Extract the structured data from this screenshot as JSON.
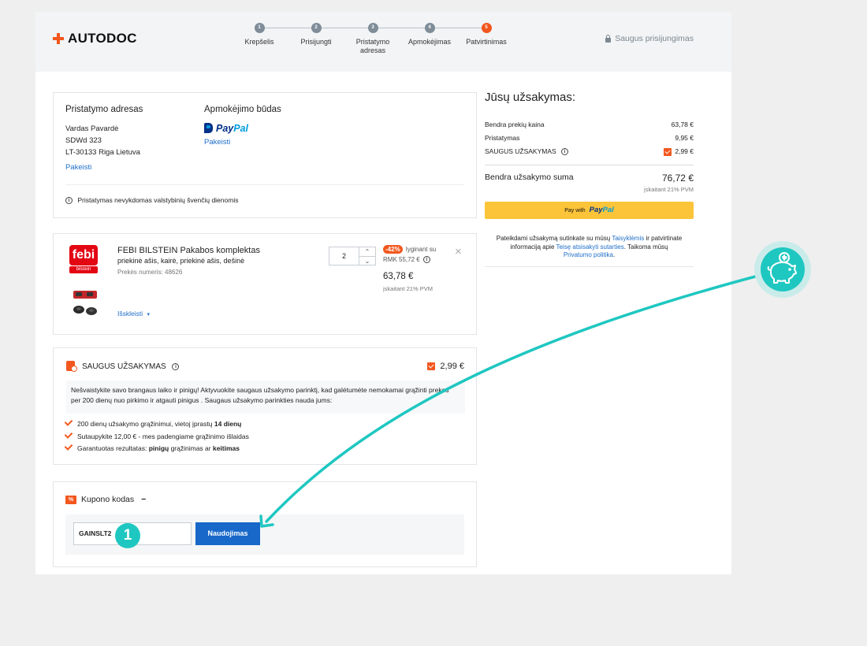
{
  "brand": {
    "name": "AUTODOC"
  },
  "steps": [
    {
      "num": "1",
      "label": "Krepšelis"
    },
    {
      "num": "2",
      "label": "Prisijungti"
    },
    {
      "num": "3",
      "label": "Pristatymo adresas"
    },
    {
      "num": "4",
      "label": "Apmokėjimas"
    },
    {
      "num": "5",
      "label": "Patvirtinimas"
    }
  ],
  "active_step": 5,
  "secure_login": "Saugus prisijungimas",
  "delivery": {
    "title": "Pristatymo adresas",
    "name": "Vardas Pavardė",
    "street": "SDWd 323",
    "city": "LT-30133 Riga Lietuva",
    "change": "Pakeisti"
  },
  "payment": {
    "title": "Apmokėjimo būdas",
    "pay": "Pay",
    "pal": "Pal",
    "change": "Pakeisti"
  },
  "holiday_notice": "Pristatymas nevykdomas valstybinių švenčių dienomis",
  "product": {
    "brand_logo": "febi",
    "brand_sub": "bilstein",
    "title": "FEBI BILSTEIN Pakabos komplektas",
    "subtitle": "priekinė ašis, kairė, priekinė ašis, dešinė",
    "sku": "Prekės numeris: 48626",
    "expand": "Išskleisti",
    "qty": "2",
    "discount": "-42%",
    "compare": "lyginant su",
    "rrp": "RMK 55,72 €",
    "price": "63,78 €",
    "vat": "įskaitant 21% PVM"
  },
  "safe_order": {
    "title": "SAUGUS UŽSAKYMAS",
    "price": "2,99 €",
    "description": "Nešvaistykite savo brangaus laiko ir pinigų! Aktyvuokite saugaus užsakymo parinktį, kad galėtumėte nemokamai grąžinti prekes per 200 dienų nuo pirkimo ir atgauti pinigus . Saugaus užsakymo parinkties nauda jums:",
    "benefits": [
      {
        "pre": "200 dienų užsakymo grąžinimui, vietoj įprastų ",
        "bold": "14 dienų",
        "post": ""
      },
      {
        "pre": "Sutaupykite 12,00 € - mes padengiame grąžinimo išlaidas",
        "bold": "",
        "post": ""
      },
      {
        "pre": "Garantuotas rezultatas: ",
        "bold": "pinigų",
        "mid": " grąžinimas ar ",
        "bold2": "keitimas"
      }
    ]
  },
  "coupon": {
    "title": "Kupono kodas",
    "collapse": "−",
    "value": "GAINSLT2",
    "apply": "Naudojimas"
  },
  "summary": {
    "title": "Jūsų užsakymas:",
    "rows": [
      {
        "label": "Bendra prekių kaina",
        "value": "63,78 €"
      },
      {
        "label": "Pristatymas",
        "value": "9,95 €"
      },
      {
        "label": "SAUGUS UŽSAKYMAS",
        "value": "2,99 €"
      }
    ],
    "total_label": "Bendra užsakymo suma",
    "total_value": "76,72 €",
    "total_vat": "įskaitant 21% PVM",
    "paypal_button": {
      "pay_with": "Pay with",
      "pay": "Pay",
      "pal": "Pal"
    },
    "terms": {
      "t1": "Pateikdami užsakymą sutinkate su mūsų ",
      "l1": "Taisyklėmis",
      "t2": " ir patvirtinate informaciją apie ",
      "l2": "Teisę atsisakyti sutarties",
      "t3": ". Taikoma mūsų ",
      "l3": "Privatumo politika",
      "t4": "."
    }
  },
  "annotation": {
    "number": "1",
    "accent": "#1fc7c1"
  },
  "colors": {
    "brand": "#f2571e",
    "link": "#1e6ec8",
    "button": "#1768c9",
    "paypal_yellow": "#fcc439"
  }
}
